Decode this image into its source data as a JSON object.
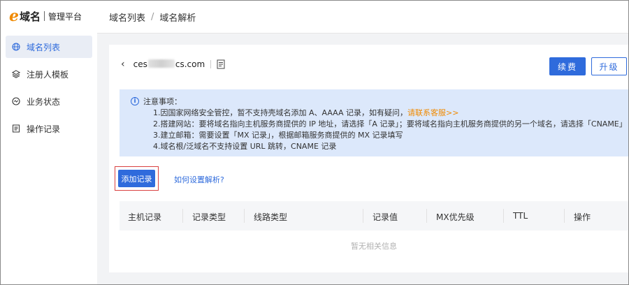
{
  "brand": {
    "logo_letter": "e",
    "name": "域名",
    "subtitle": "管理平台",
    "accent": "#2f6bdc",
    "orange": "#f08a00"
  },
  "sidebar": {
    "items": [
      {
        "label": "域名列表",
        "icon": "globe-icon",
        "active": true
      },
      {
        "label": "注册人模板",
        "icon": "layers-icon",
        "active": false
      },
      {
        "label": "业务状态",
        "icon": "status-circle-icon",
        "active": false
      },
      {
        "label": "操作记录",
        "icon": "list-doc-icon",
        "active": false
      }
    ]
  },
  "breadcrumb": {
    "parent": "域名列表",
    "separator": "/",
    "current": "域名解析"
  },
  "domain": {
    "prefix": "ces",
    "suffix": "cs.com",
    "back_icon": "chevron-left-icon",
    "info_icon": "document-icon"
  },
  "actions": {
    "renew_label": "续费",
    "upgrade_label": "升级"
  },
  "notice": {
    "icon": "info-icon",
    "title": "注意事项：",
    "line1_text": "1.因国家网络安全管控，暂不支持壳域名添加 A、AAAA 记录，如有疑问，",
    "line1_link": "请联系客服>>",
    "line2": "2.搭建网站：要将域名指向主机服务商提供的 IP 地址，请选择「A 记录」；要将域名指向主机服务商提供的另一个域名，请选择「CNAME」",
    "line3": "3.建立邮箱：需要设置「MX 记录」，根据邮箱服务商提供的 MX 记录填写",
    "line4": "4.域名根/泛域名不支持设置 URL 跳转，CNAME 记录"
  },
  "add_record_label": "添加记录",
  "help_link": "如何设置解析?",
  "table": {
    "columns": [
      "主机记录",
      "记录类型",
      "线路类型",
      "记录值",
      "MX优先级",
      "TTL",
      "操作"
    ],
    "empty_text": "暂无相关信息"
  }
}
